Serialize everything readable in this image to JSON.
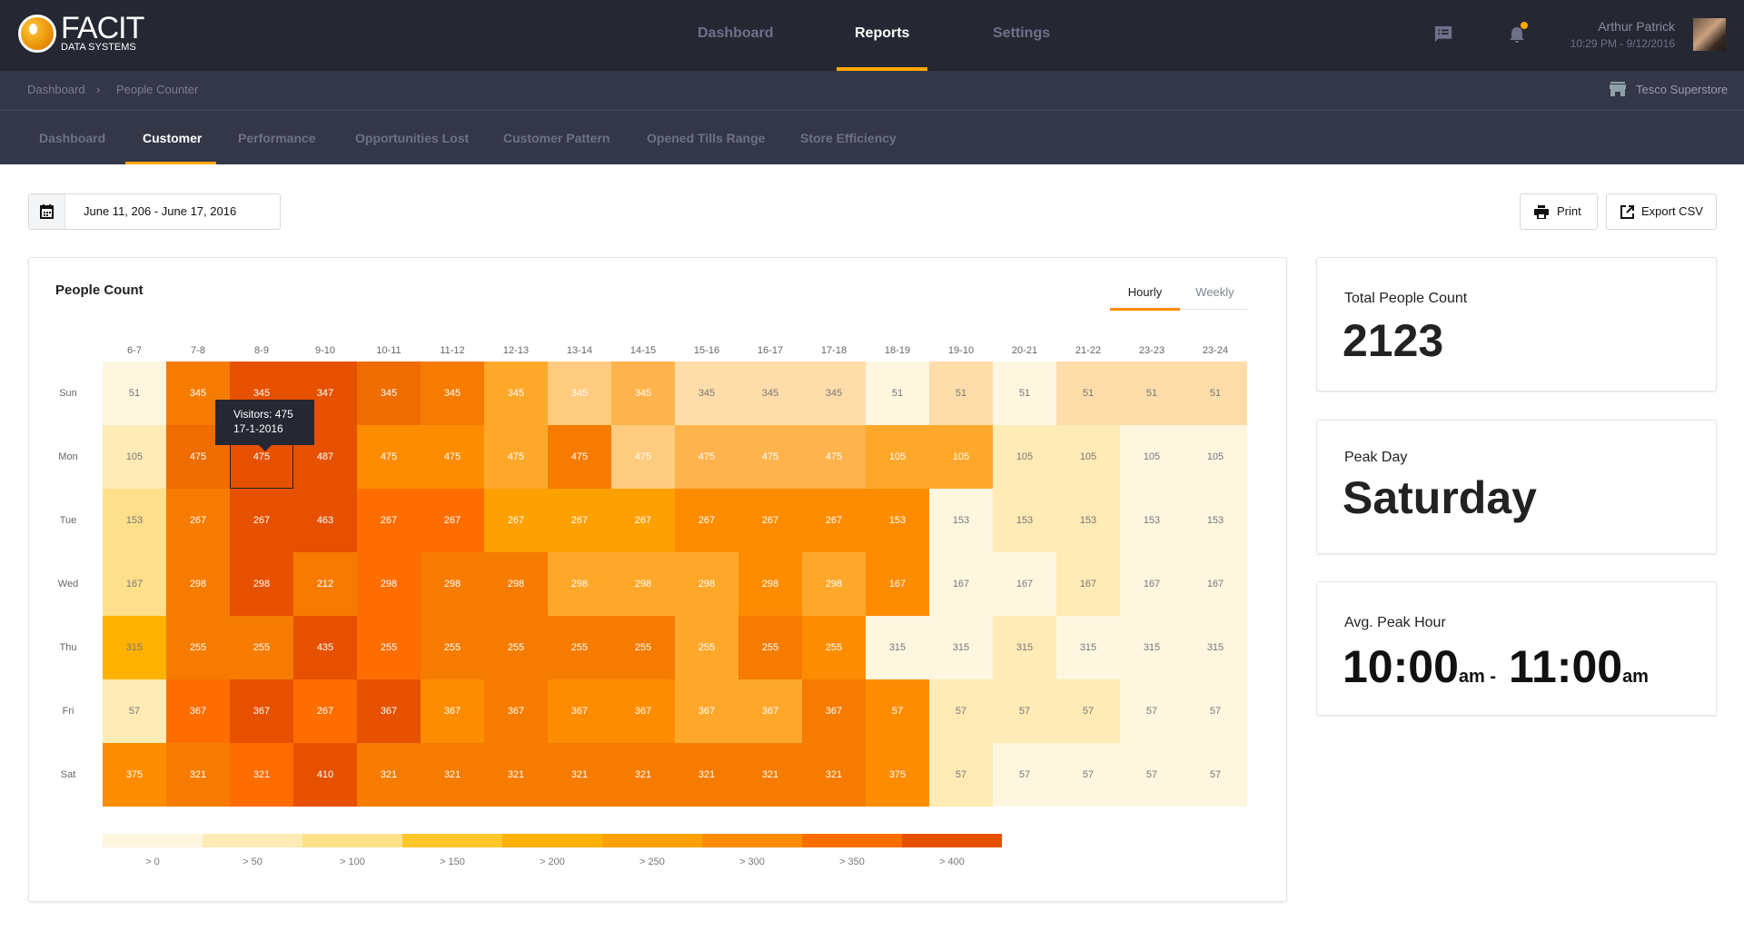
{
  "brand": {
    "name": "FACIT",
    "sub": "DATA SYSTEMS"
  },
  "nav": {
    "items": [
      {
        "label": "Dashboard"
      },
      {
        "label": "Reports",
        "active": true
      },
      {
        "label": "Settings"
      }
    ]
  },
  "user": {
    "name": "Arthur Patrick",
    "datetime": "10:29 PM - 9/12/2016",
    "notification_color": "#ffa800"
  },
  "breadcrumb": {
    "items": [
      "Dashboard",
      "People Counter"
    ]
  },
  "store": {
    "name": "Tesco Superstore"
  },
  "subtabs": [
    "Dashboard",
    "Customer",
    "Performance",
    "Opportunities Lost",
    "Customer Pattern",
    "Opened Tills Range",
    "Store Efficiency"
  ],
  "subtab_active": "Customer",
  "date_range": "June 11, 206 - June 17, 2016",
  "toolbar": {
    "print": "Print",
    "export": "Export CSV"
  },
  "panel": {
    "title": "People Count",
    "toggle": [
      "Hourly",
      "Weekly"
    ],
    "toggle_active": "Hourly"
  },
  "tooltip": {
    "line1": "Visitors: 475",
    "line2": "17-1-2016"
  },
  "stats": {
    "total_label": "Total People Count",
    "total_value": "2123",
    "peak_day_label": "Peak Day",
    "peak_day_value": "Saturday",
    "peak_hour_label": "Avg. Peak Hour",
    "peak_hour_from": "10:00",
    "peak_hour_from_suffix": "am",
    "peak_hour_sep": "-",
    "peak_hour_to": "11:00",
    "peak_hour_to_suffix": "am"
  },
  "palette": {
    "A": "#fef6df",
    "B": "#feebb5",
    "C": "#feddab",
    "D": "#fee08a",
    "E": "#fecb7f",
    "F": "#feb34c",
    "G": "#fea82b",
    "H": "#fea000",
    "I": "#feb100",
    "J": "#fe8c00",
    "K": "#f57c00",
    "L": "#fe6d00",
    "M": "#ee6c00",
    "N": "#e65100"
  },
  "chart_data": {
    "type": "heatmap",
    "x": [
      "6-7",
      "7-8",
      "8-9",
      "9-10",
      "10-11",
      "11-12",
      "12-13",
      "13-14",
      "14-15",
      "15-16",
      "16-17",
      "17-18",
      "18-19",
      "19-10",
      "20-21",
      "21-22",
      "23-23",
      "23-24"
    ],
    "y": [
      "Sun",
      "Mon",
      "Tue",
      "Wed",
      "Thu",
      "Fri",
      "Sat"
    ],
    "values": [
      [
        51,
        345,
        345,
        347,
        345,
        345,
        345,
        345,
        345,
        345,
        345,
        345,
        51,
        51,
        51,
        51,
        51,
        51
      ],
      [
        105,
        475,
        475,
        487,
        475,
        475,
        475,
        475,
        475,
        475,
        475,
        475,
        105,
        105,
        105,
        105,
        105,
        105
      ],
      [
        153,
        267,
        267,
        463,
        267,
        267,
        267,
        267,
        267,
        267,
        267,
        267,
        153,
        153,
        153,
        153,
        153,
        153
      ],
      [
        167,
        298,
        298,
        212,
        298,
        298,
        298,
        298,
        298,
        298,
        298,
        298,
        167,
        167,
        167,
        167,
        167,
        167
      ],
      [
        315,
        255,
        255,
        435,
        255,
        255,
        255,
        255,
        255,
        255,
        255,
        255,
        315,
        315,
        315,
        315,
        315,
        315
      ],
      [
        57,
        367,
        367,
        267,
        367,
        367,
        367,
        367,
        367,
        367,
        367,
        367,
        57,
        57,
        57,
        57,
        57,
        57
      ],
      [
        375,
        321,
        321,
        410,
        321,
        321,
        321,
        321,
        321,
        321,
        321,
        321,
        375,
        57,
        57,
        57,
        57,
        57
      ]
    ],
    "cell_colors": [
      "AKNNMKGEFCCCACACCC",
      "BMNNJJGKEFFFGGBBAA",
      "DKNNLLHHHJJJJABBAA",
      "DKNKLKKGGGJGJAABAA",
      "IKKNLKKKKGKJAABAAA",
      "BLNLNJKJJGGKJBBBAA",
      "JKLNKKKKKKKKJBAAAA"
    ],
    "dark_text_colors": [
      "A",
      "B",
      "C",
      "D",
      "I"
    ],
    "highlighted_cell": {
      "day": "Mon",
      "hour": "8-9"
    },
    "legend": {
      "labels": [
        "> 0",
        "> 50",
        "> 100",
        "> 150",
        "> 200",
        "> 250",
        "> 300",
        "> 350",
        "> 400"
      ],
      "colors": [
        "#fef6df",
        "#feebb5",
        "#fee08a",
        "#fec72a",
        "#feb100",
        "#fea000",
        "#fe8c00",
        "#fe6d00",
        "#e65100"
      ],
      "placement": "bottom"
    }
  }
}
